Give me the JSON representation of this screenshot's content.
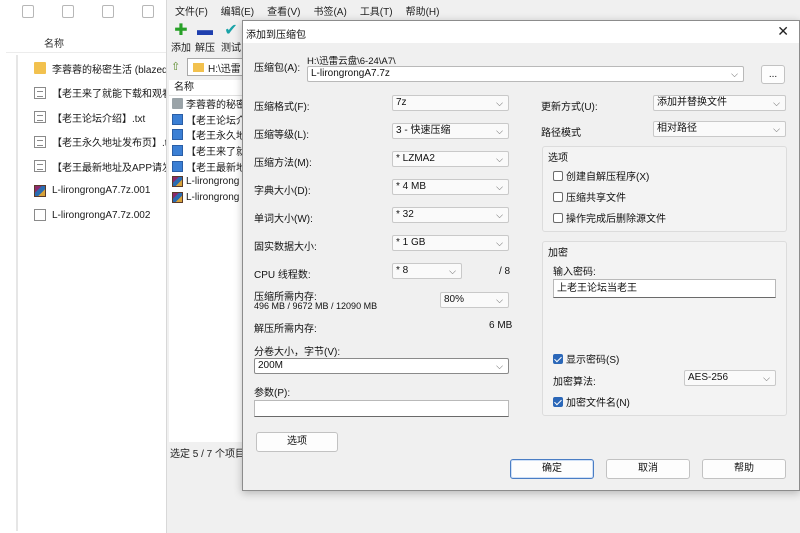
{
  "explorer": {
    "column_header": "名称",
    "items": [
      {
        "name": "李蓉蓉的秘密生活 (blazed",
        "icon": "folder-icon"
      },
      {
        "name": "【老王来了就能下载和观看",
        "icon": "text-file-icon"
      },
      {
        "name": "【老王论坛介绍】.txt",
        "icon": "text-file-icon"
      },
      {
        "name": "【老王永久地址发布页】.t",
        "icon": "text-file-icon"
      },
      {
        "name": "【老王最新地址及APP请发",
        "icon": "text-file-icon"
      },
      {
        "name": "L-lirongrongA7.7z.001",
        "icon": "rar-archive-icon"
      },
      {
        "name": "L-lirongrongA7.7z.002",
        "icon": "file-icon"
      }
    ]
  },
  "zip_main": {
    "menu": [
      "文件(F)",
      "编辑(E)",
      "查看(V)",
      "书签(A)",
      "工具(T)",
      "帮助(H)"
    ],
    "toolbar": {
      "add": "添加",
      "extract": "解压",
      "test": "测试"
    },
    "address": "H:\\迅雷",
    "column_name": "名称",
    "files": [
      {
        "name": "李蓉蓉的秘密",
        "icon": "folder-icon"
      },
      {
        "name": "【老王论坛介",
        "icon": "text-file-icon"
      },
      {
        "name": "【老王永久地",
        "icon": "text-file-icon"
      },
      {
        "name": "【老王来了就",
        "icon": "text-file-icon"
      },
      {
        "name": "【老王最新地",
        "icon": "text-file-icon"
      },
      {
        "name": "L-lirongrong",
        "icon": "rar-archive-icon"
      },
      {
        "name": "L-lirongrong",
        "icon": "rar-archive-icon"
      }
    ],
    "status": "选定 5 / 7 个项目"
  },
  "dialog": {
    "title": "添加到压缩包",
    "archive_label": "压缩包(A):",
    "archive_path": "H:\\迅雷云盘\\6-24\\A7\\",
    "archive_name": "L-lirongrongA7.7z",
    "browse": "...",
    "format_label": "压缩格式(F):",
    "format_value": "7z",
    "level_label": "压缩等级(L):",
    "level_value": "3 - 快速压缩",
    "method_label": "压缩方法(M):",
    "method_value": "* LZMA2",
    "dict_label": "字典大小(D):",
    "dict_value": "* 4 MB",
    "word_label": "单词大小(W):",
    "word_value": "* 32",
    "solid_label": "固实数据大小:",
    "solid_value": "* 1 GB",
    "threads_label": "CPU 线程数:",
    "threads_value": "* 8",
    "threads_max": "/ 8",
    "mem_comp_label": "压缩所需内存:",
    "mem_comp_detail": "496 MB / 9672 MB / 12090 MB",
    "mem_percent": "80%",
    "mem_decomp_label": "解压所需内存:",
    "mem_decomp_value": "6 MB",
    "split_label": "分卷大小，字节(V):",
    "split_value": "200M",
    "params_label": "参数(P):",
    "params_value": "",
    "options_button": "选项",
    "update_label": "更新方式(U):",
    "update_value": "添加并替换文件",
    "path_label": "路径模式",
    "path_value": "相对路径",
    "options_group": "选项",
    "opt_sfx": "创建自解压程序(X)",
    "opt_shared": "压缩共享文件",
    "opt_delete": "操作完成后删除源文件",
    "encrypt_group": "加密",
    "password_label": "输入密码:",
    "password_value": "上老王论坛当老王",
    "show_password": "显示密码(S)",
    "enc_method_label": "加密算法:",
    "enc_method_value": "AES-256",
    "encrypt_names": "加密文件名(N)",
    "ok": "确定",
    "cancel": "取消",
    "help": "帮助",
    "show_password_checked": true,
    "encrypt_names_checked": true,
    "opt_sfx_checked": false,
    "opt_shared_checked": false,
    "opt_delete_checked": false
  }
}
